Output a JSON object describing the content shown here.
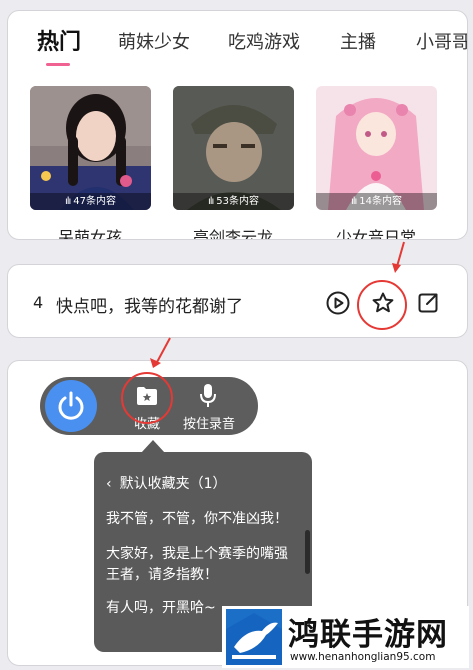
{
  "tabs": [
    {
      "label": "热门",
      "active": true
    },
    {
      "label": "萌妹少女",
      "active": false
    },
    {
      "label": "吃鸡游戏",
      "active": false
    },
    {
      "label": "主播",
      "active": false
    },
    {
      "label": "小哥哥",
      "active": false
    }
  ],
  "thumbnails": [
    {
      "count": "47条内容",
      "title": "呆萌女孩"
    },
    {
      "count": "53条内容",
      "title": "亮剑李云龙"
    },
    {
      "count": "14条内容",
      "title": "少女音日常"
    }
  ],
  "row": {
    "index": "4",
    "text": "快点吧，我等的花都谢了",
    "icons": [
      "play-icon",
      "star-icon",
      "share-icon"
    ]
  },
  "float_bar": {
    "items": [
      {
        "icon": "power-icon",
        "label": ""
      },
      {
        "icon": "folder-star-icon",
        "label": "收藏"
      },
      {
        "icon": "microphone-icon",
        "label": "按住录音"
      }
    ]
  },
  "popup": {
    "header": "默认收藏夹（1）",
    "items": [
      "我不管，不管，你不准凶我！",
      "大家好，我是上个赛季的嘴强王者，请多指教！",
      "有人吗，开黑哈~"
    ]
  },
  "watermark": {
    "title": "鸿联手游网",
    "url": "www.henanhonglian95.com"
  },
  "colors": {
    "accent_pink": "#f06292",
    "power_blue": "#4a90f0",
    "annotation_red": "#e53935",
    "panel_gray": "#5a5a5a"
  }
}
